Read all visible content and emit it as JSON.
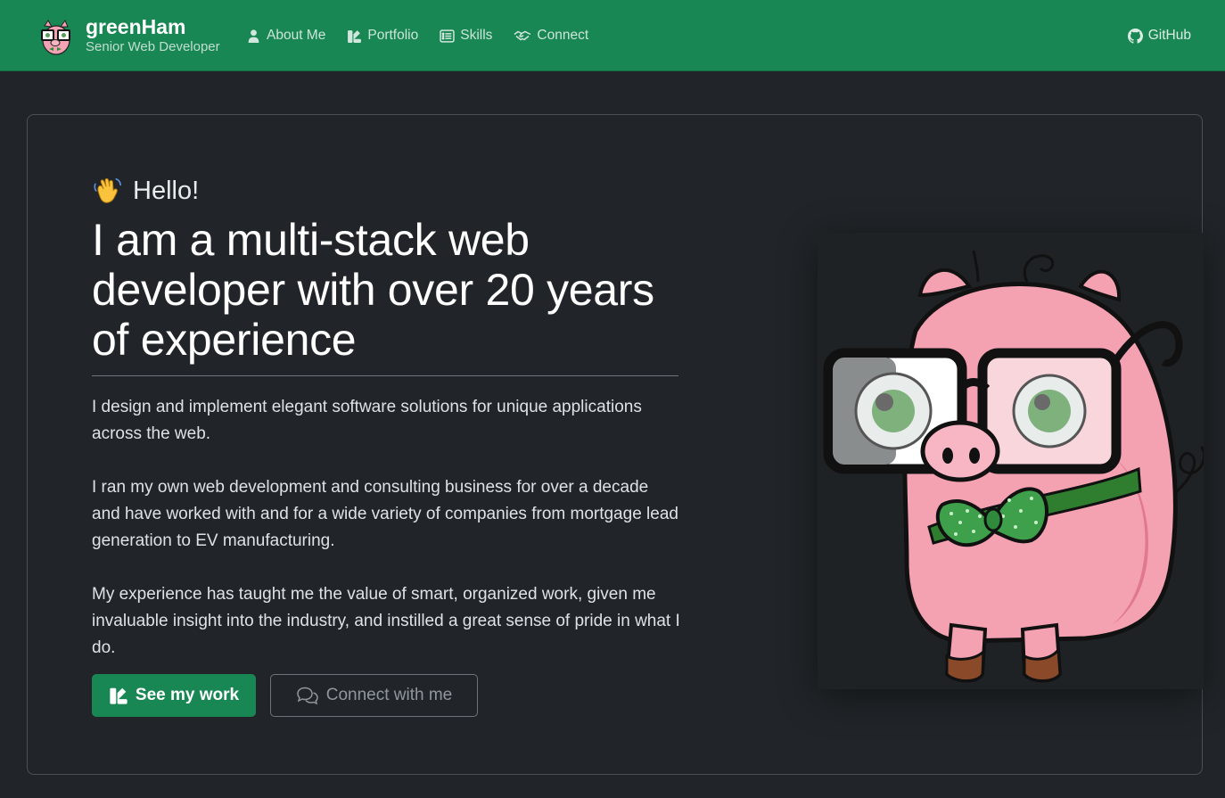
{
  "brand": {
    "name": "greenHam",
    "subtitle": "Senior Web Developer",
    "logo_icon": "pig-mascot-icon"
  },
  "nav": {
    "items": [
      {
        "label": "About Me",
        "icon": "person-icon"
      },
      {
        "label": "Portfolio",
        "icon": "portfolio-icon"
      },
      {
        "label": "Skills",
        "icon": "list-icon"
      },
      {
        "label": "Connect",
        "icon": "handshake-icon"
      }
    ],
    "github_label": "GitHub",
    "github_icon": "github-icon"
  },
  "hero": {
    "greeting": "Hello!",
    "greeting_icon": "waving-hand-icon",
    "headline": "I am a multi-stack web developer with over 20 years of experience",
    "paragraphs": [
      "I design and implement elegant software solutions for unique applications across the web.",
      "I ran my own web development and consulting business for over a decade and have worked with and for a wide variety of companies from mortgage lead generation to EV manufacturing.",
      "My experience has taught me the value of smart, organized work, given me invaluable insight into the industry, and instilled a great sense of pride in what I do."
    ],
    "primary_button": "See my work",
    "secondary_button": "Connect with me"
  },
  "colors": {
    "navbar": "#198754",
    "background": "#212529",
    "primary": "#198754"
  }
}
